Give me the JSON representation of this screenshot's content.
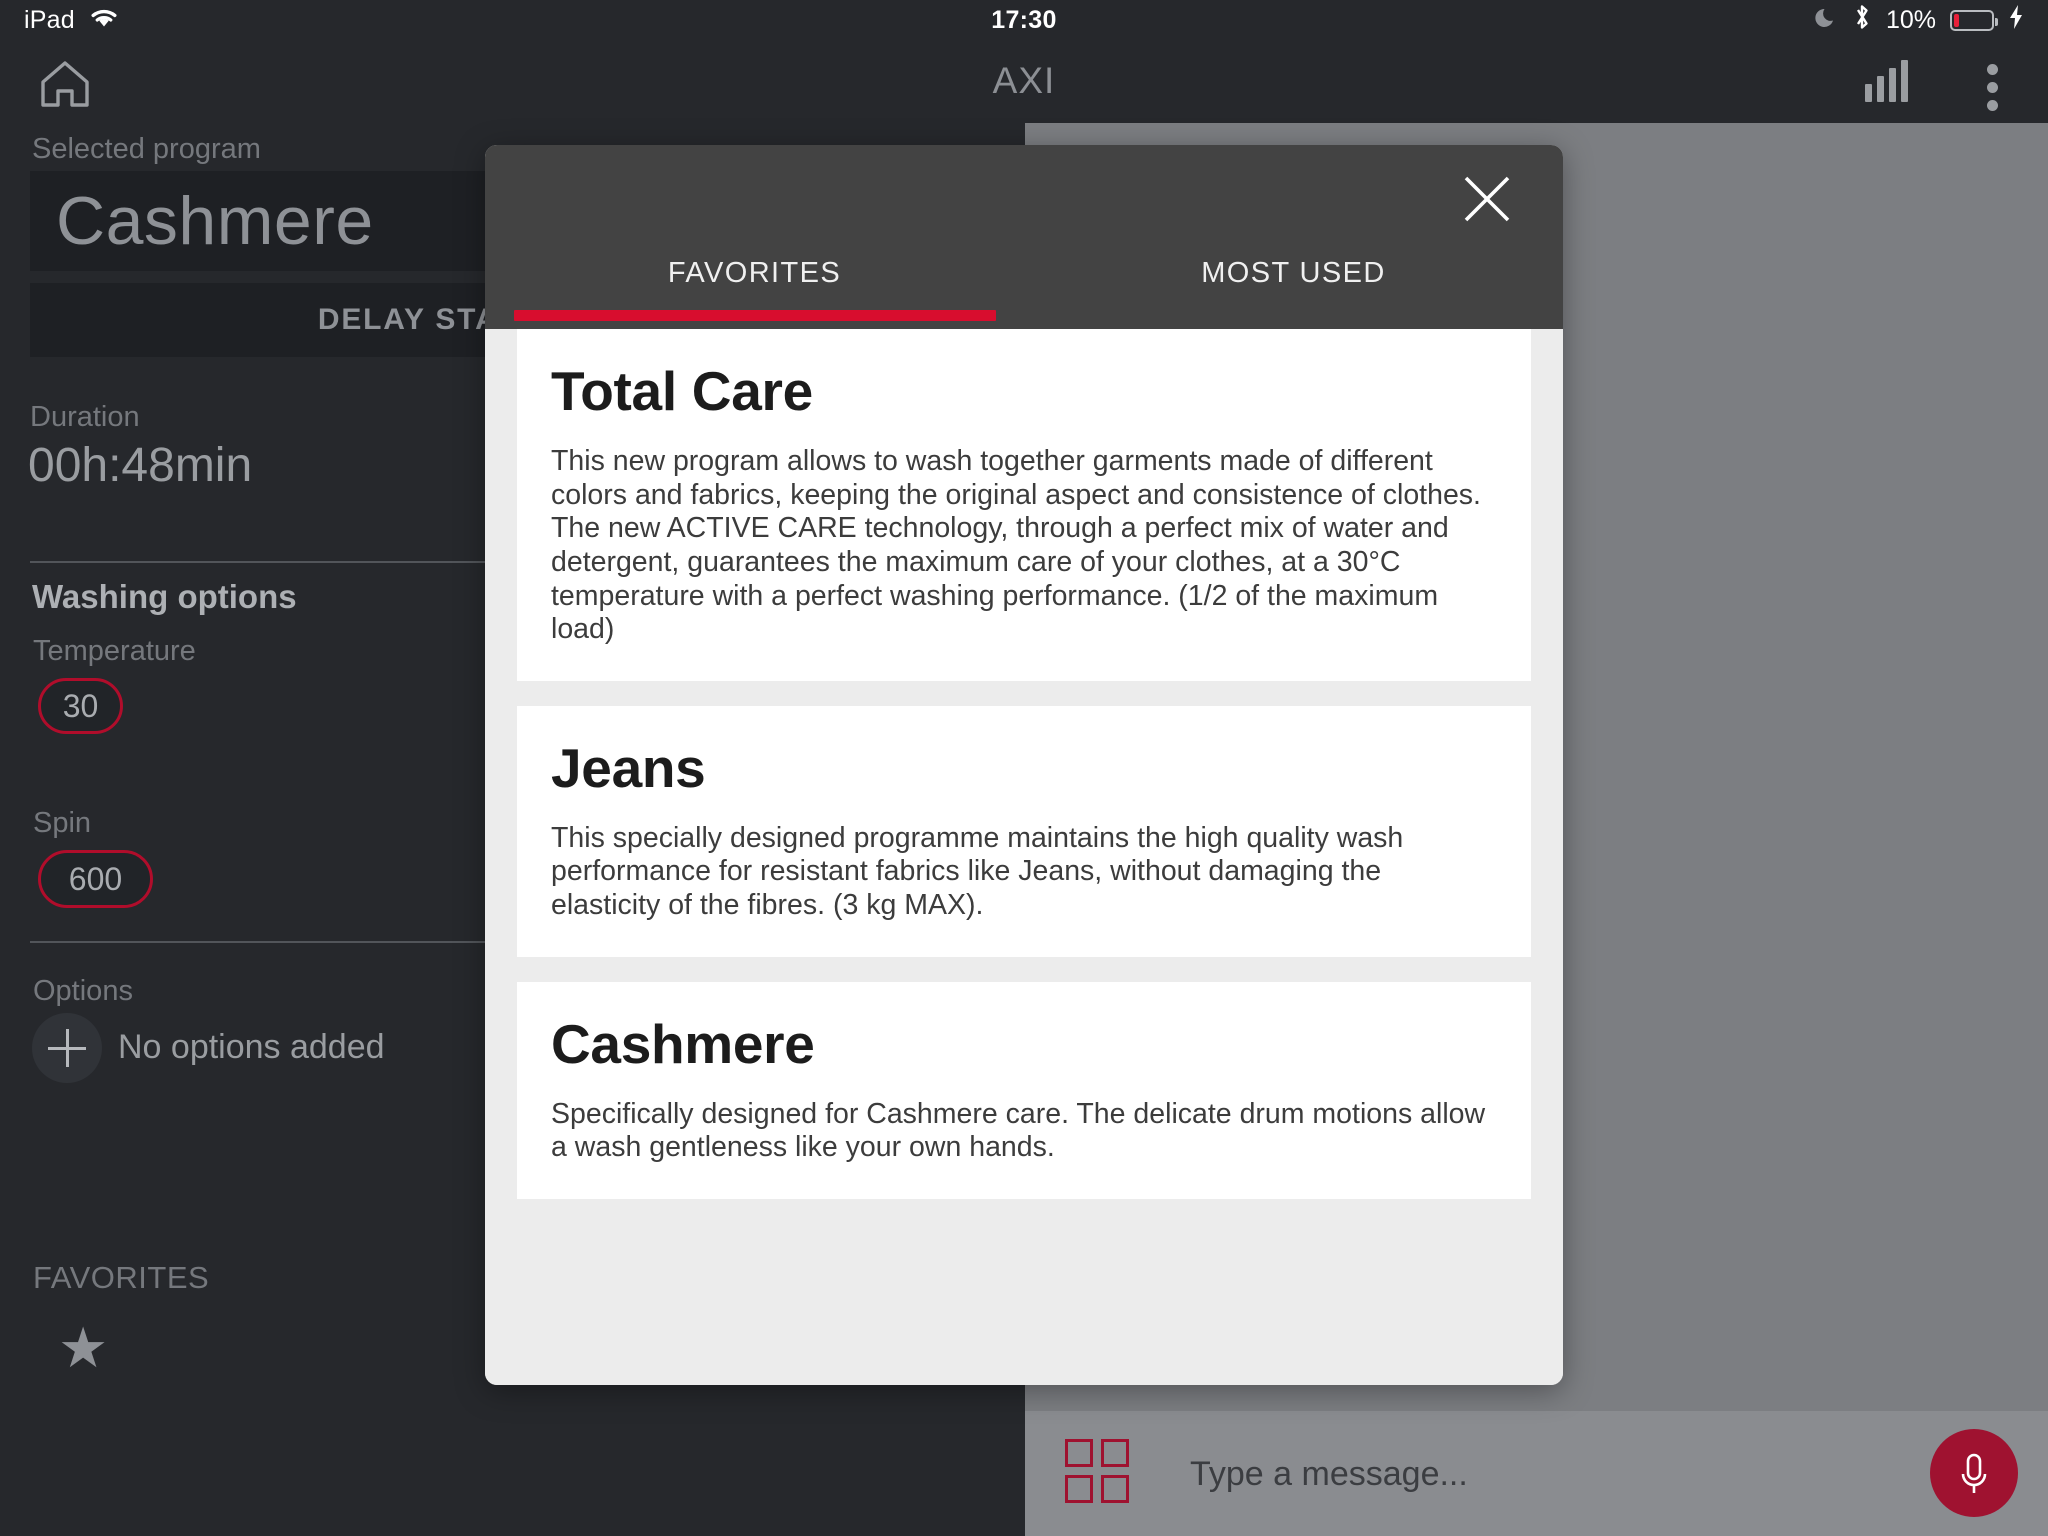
{
  "statusbar": {
    "device": "iPad",
    "wifi_icon": "wifi-icon",
    "time": "17:30",
    "moon_icon": "moon-icon",
    "bluetooth_icon": "bluetooth-icon",
    "battery_percent": "10%",
    "charging_icon": "lightning-bolt-icon"
  },
  "appbar": {
    "home_icon": "home-icon",
    "title": "AXI",
    "signal_icon": "signal-bars-icon",
    "menu_icon": "kebab-menu-icon"
  },
  "sidebar": {
    "selected_program_label": "Selected program",
    "program_name": "Cashmere",
    "delay_start_label": "DELAY START",
    "duration_label": "Duration",
    "duration_value": "00h:48min",
    "washing_options_title": "Washing options",
    "temperature_label": "Temperature",
    "temperature_value": "30",
    "spin_label": "Spin",
    "spin_value": "600",
    "options_label": "Options",
    "no_options_text": "No options added",
    "add_option_icon": "plus-icon",
    "favorites_title": "FAVORITES",
    "favorite_star_icon": "star-icon"
  },
  "modal": {
    "close_icon": "close-icon",
    "tabs": [
      {
        "label": "FAVORITES",
        "active": true
      },
      {
        "label": "MOST USED",
        "active": false
      }
    ],
    "accent_color": "#d80d2e",
    "programs": [
      {
        "title": "Total Care",
        "description": "This new program allows to wash together garments made of different colors and fabrics, keeping the original aspect and consistence of clothes. The new ACTIVE CARE technology, through a perfect mix of water and detergent, guarantees the maximum care of your clothes, at a 30°C temperature with a perfect washing performance. (1/2 of the maximum load)"
      },
      {
        "title": "Jeans",
        "description": "This specially designed programme maintains the high quality wash performance for resistant fabrics like Jeans, without damaging the elasticity of the fibres. (3 kg MAX)."
      },
      {
        "title": "Cashmere",
        "description": "Specifically designed for Cashmere care. The delicate drum motions allow a wash gentleness like your own hands."
      }
    ]
  },
  "chatbar": {
    "grid_icon": "grid-apps-icon",
    "placeholder": "Type a message...",
    "mic_icon": "microphone-icon",
    "mic_color": "#9f1230"
  }
}
